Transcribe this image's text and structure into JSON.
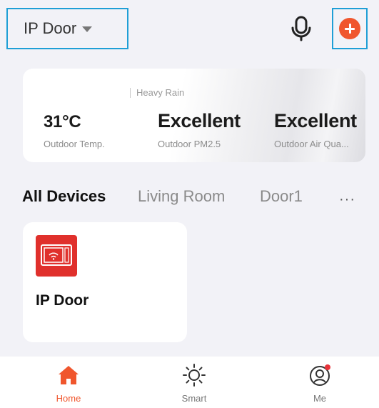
{
  "header": {
    "home_name": "IP Door",
    "icons": {
      "dropdown": "caret-down-icon",
      "voice": "microphone-icon",
      "add": "plus-circle-icon"
    },
    "colors": {
      "accent": "#f0562d",
      "highlight_border": "#1f9fd6"
    }
  },
  "weather": {
    "condition": "Heavy Rain",
    "metrics": [
      {
        "value": "31°C",
        "label": "Outdoor Temp."
      },
      {
        "value": "Excellent",
        "label": "Outdoor PM2.5"
      },
      {
        "value": "Excellent",
        "label": "Outdoor Air Qua..."
      }
    ]
  },
  "rooms": {
    "tabs": [
      {
        "label": "All Devices",
        "active": true
      },
      {
        "label": "Living Room",
        "active": false
      },
      {
        "label": "Door1",
        "active": false
      }
    ],
    "more_label": "···"
  },
  "devices": [
    {
      "name": "IP Door",
      "icon": "intercom-monitor-icon",
      "icon_color": "#e0302c"
    }
  ],
  "tabbar": {
    "items": [
      {
        "label": "Home",
        "icon": "home-icon",
        "active": true
      },
      {
        "label": "Smart",
        "icon": "sun-icon",
        "active": false
      },
      {
        "label": "Me",
        "icon": "user-icon",
        "active": false,
        "badge": true
      }
    ]
  }
}
